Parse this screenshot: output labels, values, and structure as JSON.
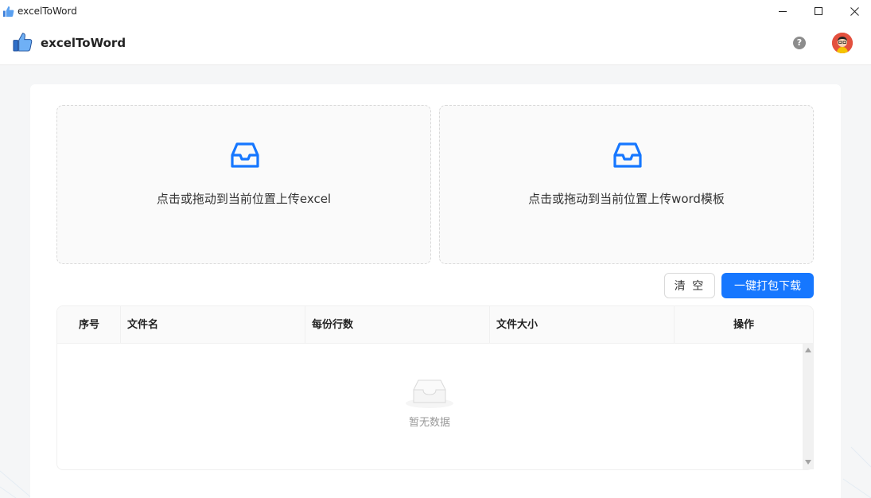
{
  "window": {
    "title": "excelToWord",
    "icon": "thumbs-up-icon"
  },
  "header": {
    "brand": "excelToWord",
    "help_label": "?",
    "avatar": "avatar-icon"
  },
  "upload": {
    "excel_hint": "点击或拖动到当前位置上传excel",
    "word_hint": "点击或拖动到当前位置上传word模板",
    "icon": "inbox-icon"
  },
  "actions": {
    "clear_label": "清 空",
    "download_label": "一键打包下载"
  },
  "table": {
    "columns": [
      "序号",
      "文件名",
      "每份行数",
      "文件大小",
      "操作"
    ],
    "rows": [],
    "empty_text": "暂无数据"
  },
  "colors": {
    "primary": "#1677ff",
    "accent_icon": "#1677ff",
    "header_bg": "#fafafa"
  }
}
